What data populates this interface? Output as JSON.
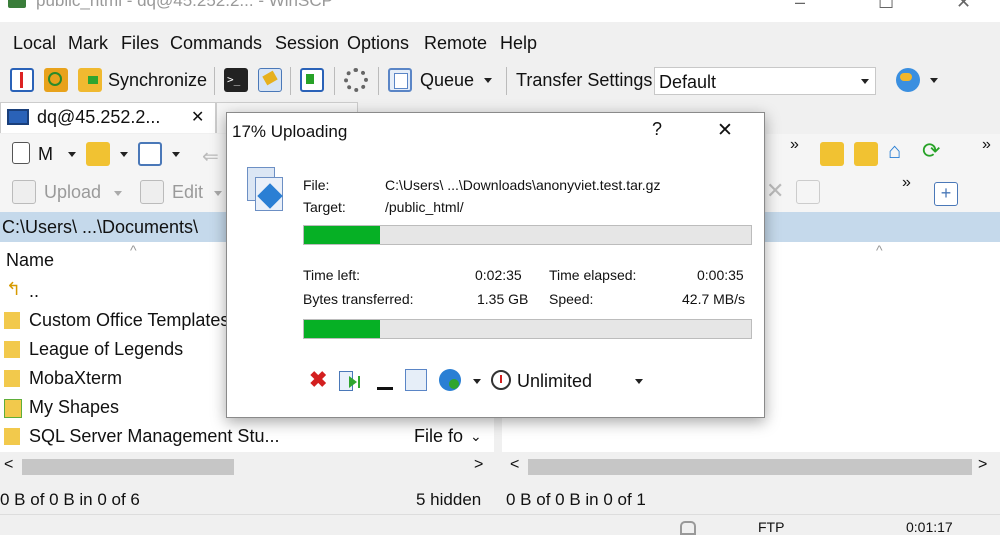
{
  "window": {
    "title": "public_html - dq@45.252.2... - WinSCP",
    "controls": [
      "–",
      "☐",
      "✕"
    ]
  },
  "menu": [
    "Local",
    "Mark",
    "Files",
    "Commands",
    "Session",
    "Options",
    "Remote",
    "Help"
  ],
  "toolbar": {
    "synchronize": "Synchronize",
    "queue": "Queue",
    "transfer_settings_label": "Transfer Settings",
    "transfer_settings_value": "Default"
  },
  "tab": {
    "label": "dq@45.252.2...",
    "close": "✕"
  },
  "left_toolbar": {
    "view_value": "M",
    "upload": "Upload",
    "edit": "Edit"
  },
  "left_panel": {
    "path": "C:\\Users\\ ...\\Documents\\",
    "column_name": "Name",
    "column_type": "File fo",
    "files": [
      {
        "name": "..",
        "icon": "parent-dir-icon"
      },
      {
        "name": "Custom Office Templates",
        "icon": "folder-icon"
      },
      {
        "name": "League of Legends",
        "icon": "folder-icon"
      },
      {
        "name": "MobaXterm",
        "icon": "folder-icon"
      },
      {
        "name": "My Shapes",
        "icon": "special-folder-icon"
      },
      {
        "name": "SQL Server Management Stu...",
        "icon": "folder-icon"
      }
    ],
    "status": "0 B of 0 B in 0 of 6",
    "hidden": "5 hidden"
  },
  "right_panel": {
    "status": "0 B of 0 B in 0 of 1"
  },
  "bottom_bar": {
    "protocol": "FTP",
    "timer": "0:01:17"
  },
  "dialog": {
    "title": "17% Uploading",
    "help": "?",
    "close": "✕",
    "file_label": "File:",
    "file_value": "C:\\Users\\ ...\\Downloads\\anonyviet.test.tar.gz",
    "target_label": "Target:",
    "target_value": "/public_html/",
    "file_progress": 0.17,
    "time_left_label": "Time left:",
    "time_left_value": "0:02:35",
    "time_elapsed_label": "Time elapsed:",
    "time_elapsed_value": "0:00:35",
    "bytes_label": "Bytes transferred:",
    "bytes_value": "1.35 GB",
    "speed_label": "Speed:",
    "speed_value": "42.7 MB/s",
    "total_progress": 0.17,
    "speed_limit": "Unlimited"
  },
  "colors": {
    "progress": "#06b025",
    "path_bar": "#c5d9eb",
    "accent_blue": "#2a7fd4"
  }
}
